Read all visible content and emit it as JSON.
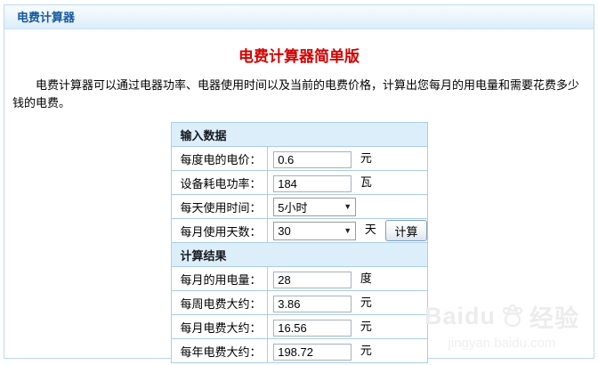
{
  "window": {
    "title": "电费计算器"
  },
  "page": {
    "title": "电费计算器简单版",
    "description": "电费计算器可以通过电器功率、电器使用时间以及当前的电费价格，计算出您每月的用电量和需要花费多少钱的电费。"
  },
  "form": {
    "input_header": "输入数据",
    "result_header": "计算结果",
    "calc_button": "计算",
    "rows": [
      {
        "label": "每度电的电价：",
        "value": "0.6",
        "unit": "元",
        "control": "input"
      },
      {
        "label": "设备耗电功率：",
        "value": "184",
        "unit": "瓦",
        "control": "input"
      },
      {
        "label": "每天使用时间：",
        "value": "5小时",
        "unit": "",
        "control": "select"
      },
      {
        "label": "每月使用天数：",
        "value": "30",
        "unit": "天",
        "control": "select"
      },
      {
        "label": "每月的用电量：",
        "value": "28",
        "unit": "度",
        "control": "input"
      },
      {
        "label": "每周电费大约：",
        "value": "3.86",
        "unit": "元",
        "control": "input"
      },
      {
        "label": "每月电费大约：",
        "value": "16.56",
        "unit": "元",
        "control": "input"
      },
      {
        "label": "每年电费大约：",
        "value": "198.72",
        "unit": "元",
        "control": "input"
      }
    ]
  },
  "watermark": {
    "brand": "Baidu",
    "suffix": "经验",
    "url": "jingyan.baidu.com"
  },
  "colors": {
    "titlebar_text": "#1558a0",
    "page_title_red": "#d40000",
    "table_border": "#a9cee8",
    "section_bg": "#ddeefb"
  }
}
